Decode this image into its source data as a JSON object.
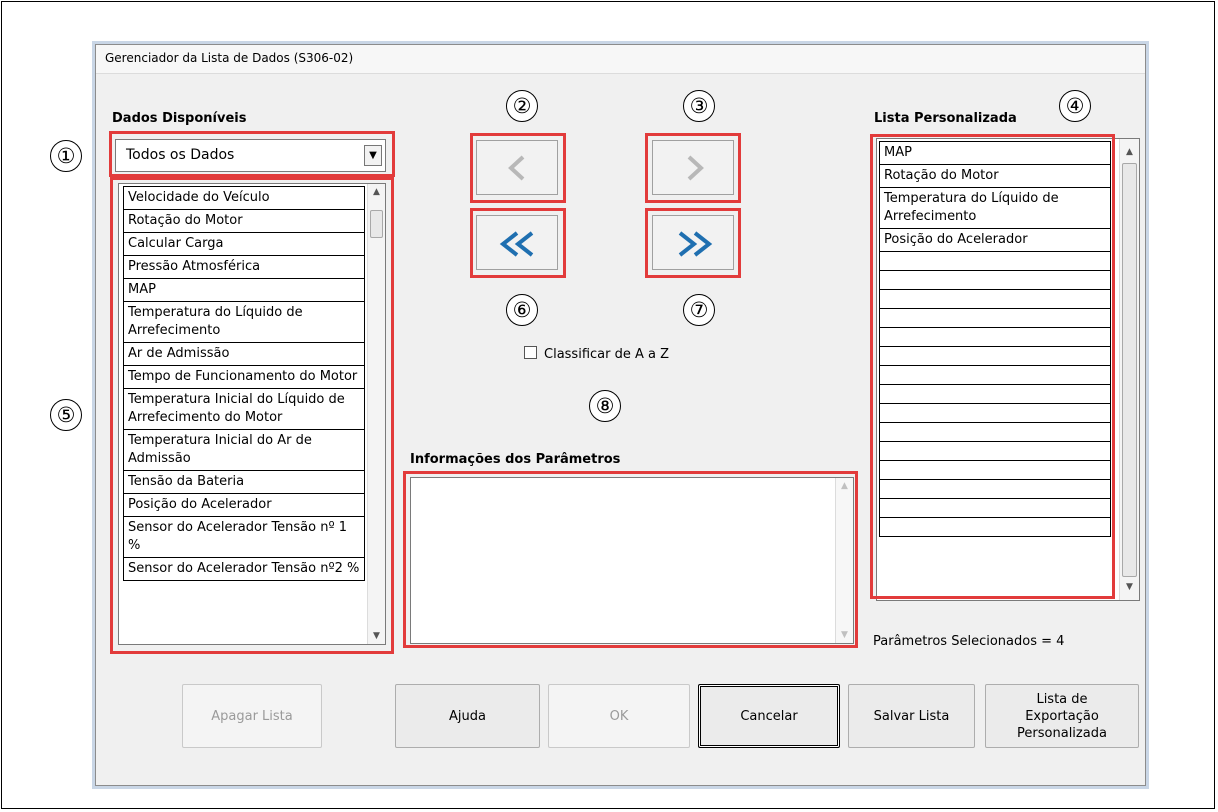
{
  "window": {
    "title": "Gerenciador da Lista de Dados (S306-02)"
  },
  "available": {
    "heading": "Dados Disponíveis",
    "dropdown_value": "Todos os Dados",
    "items": [
      "Velocidade do Veículo",
      "Rotação do Motor",
      "Calcular Carga",
      "Pressão Atmosférica",
      "MAP",
      "Temperatura do Líquido de Arrefecimento",
      "Ar de Admissão",
      "Tempo de Funcionamento do Motor",
      "Temperatura Inicial do Líquido de Arrefecimento do Motor",
      "Temperatura Inicial do Ar de Admissão",
      "Tensão da Bateria",
      "Posição do Acelerador",
      "Sensor do Acelerador Tensão nº 1 %",
      "Sensor do Acelerador Tensão nº2 %"
    ]
  },
  "custom": {
    "heading": "Lista Personalizada",
    "items": [
      "MAP",
      "Rotação do Motor",
      "Temperatura do Líquido de Arrefecimento",
      "Posição do Acelerador",
      "",
      "",
      "",
      "",
      "",
      "",
      "",
      "",
      "",
      "",
      "",
      "",
      "",
      "",
      ""
    ],
    "selected_status": "Parâmetros Selecionados = 4"
  },
  "options": {
    "sort_label": "Classificar de A a Z",
    "sort_checked": false
  },
  "info": {
    "heading": "Informações dos Parâmetros"
  },
  "callouts": [
    "①",
    "②",
    "③",
    "④",
    "⑤",
    "⑥",
    "⑦",
    "⑧"
  ],
  "nav_icons": [
    "chevron-left-icon",
    "chevron-right-icon",
    "double-chevron-left-icon",
    "double-chevron-right-icon"
  ],
  "buttons": {
    "clear": "Apagar Lista",
    "help": "Ajuda",
    "ok": "OK",
    "cancel": "Cancelar",
    "save": "Salvar Lista",
    "export": "Lista de Exportação Personalizada"
  },
  "colors": {
    "highlight": "#e23b3b",
    "arrow_single": "#b8b8b8",
    "arrow_double": "#1f6fb0"
  }
}
